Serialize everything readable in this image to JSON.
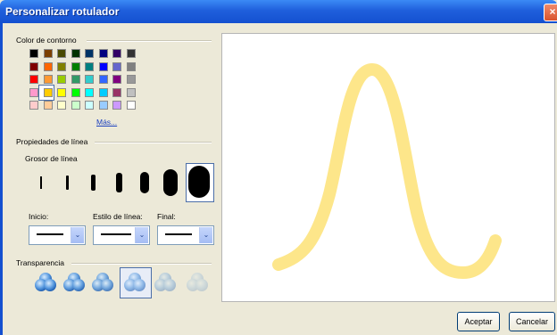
{
  "window": {
    "title": "Personalizar rotulador",
    "close_glyph": "×"
  },
  "groups": {
    "outline_color": "Color de contorno",
    "line_properties": "Propiedades de línea",
    "line_thickness": "Grosor de línea",
    "transparency": "Transparencia"
  },
  "colors": {
    "rows": [
      [
        "#000000",
        "#7b3f00",
        "#4a4a00",
        "#003300",
        "#003366",
        "#000080",
        "#330066",
        "#333333"
      ],
      [
        "#800000",
        "#ff6600",
        "#808000",
        "#008000",
        "#008080",
        "#0000ff",
        "#6666cc",
        "#808080"
      ],
      [
        "#ff0000",
        "#ff9933",
        "#99cc00",
        "#339966",
        "#33cccc",
        "#3366ff",
        "#800080",
        "#999999"
      ],
      [
        "#ff99cc",
        "#ffcc00",
        "#ffff00",
        "#00ff00",
        "#00ffff",
        "#00ccff",
        "#993366",
        "#c0c0c0"
      ],
      [
        "#ffcccc",
        "#ffcc99",
        "#ffffcc",
        "#ccffcc",
        "#ccffff",
        "#99ccff",
        "#cc99ff",
        "#ffffff"
      ]
    ],
    "selected": "#ffcc00",
    "more_link": "Más..."
  },
  "line_start": {
    "label": "Inicio:",
    "arrow": "⌄"
  },
  "line_style": {
    "label": "Estilo de línea:",
    "arrow": "⌄"
  },
  "line_end": {
    "label": "Final:",
    "arrow": "⌄"
  },
  "preview": {
    "stroke_color": "#fde68a"
  },
  "buttons": {
    "accept": "Aceptar",
    "cancel": "Cancelar"
  }
}
